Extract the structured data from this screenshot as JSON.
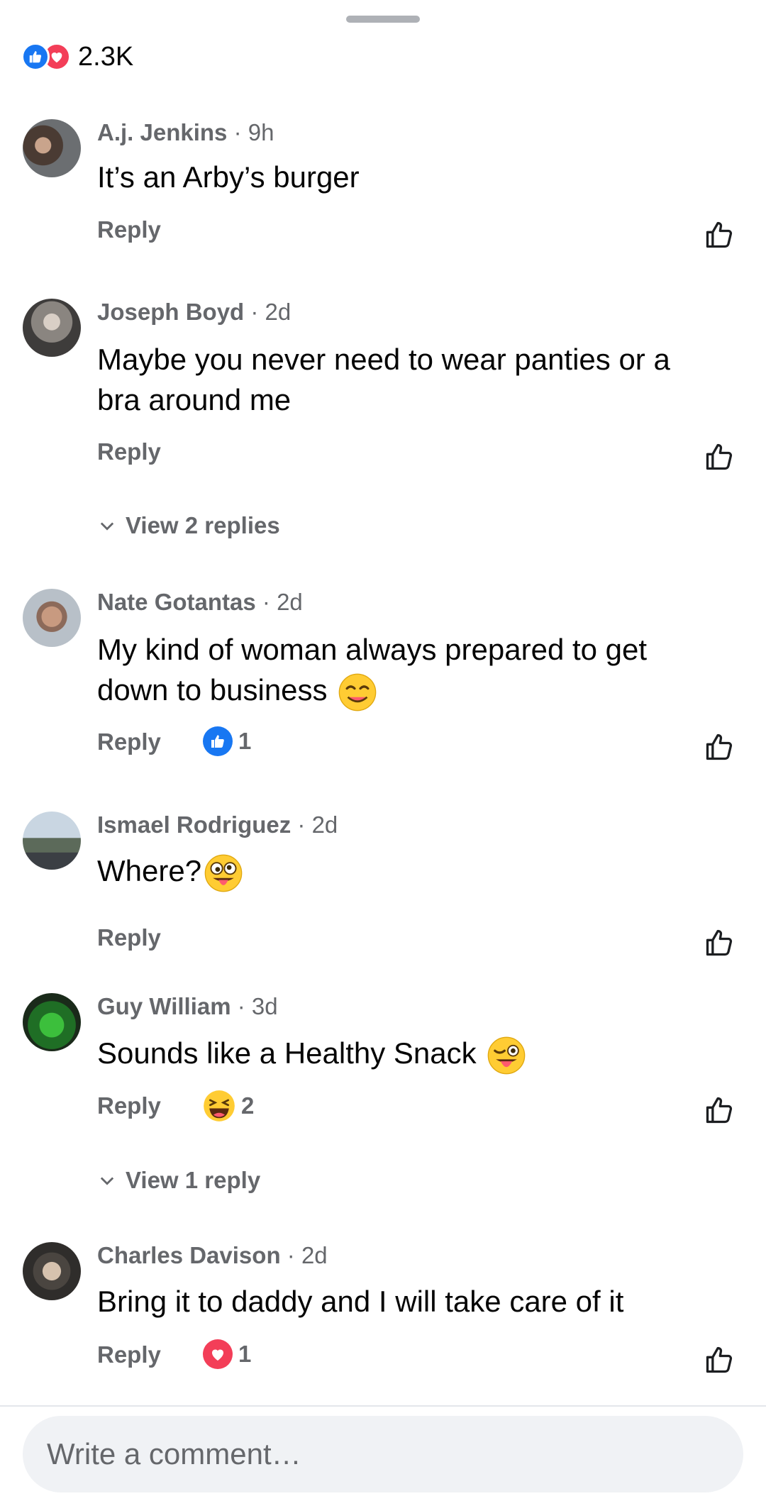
{
  "reactions_summary": {
    "count": "2.3K",
    "types": [
      "like-icon",
      "love-icon"
    ],
    "colors": {
      "like": "#1877f2",
      "love": "#f33e58"
    }
  },
  "comments": [
    {
      "author": "A.j. Jenkins",
      "separator": "·",
      "time": "9h",
      "text": "It’s an Arby’s burger",
      "reply_label": "Reply"
    },
    {
      "author": "Joseph Boyd",
      "separator": "·",
      "time": "2d",
      "text": "Maybe you never need to wear panties or a bra around me",
      "reply_label": "Reply",
      "view_replies": "View 2 replies"
    },
    {
      "author": "Nate Gotantas",
      "separator": "·",
      "time": "2d",
      "text": "My kind of woman always prepared to get down to business",
      "emoji": "smirk-face",
      "reply_label": "Reply",
      "reaction": {
        "type": "like",
        "count": "1"
      }
    },
    {
      "author": "Ismael Rodriguez",
      "separator": "·",
      "time": "2d",
      "text": "Where?",
      "emoji": "goofy-tongue-face",
      "reply_label": "Reply"
    },
    {
      "author": "Guy William",
      "separator": "·",
      "time": "3d",
      "text": "Sounds like a Healthy Snack",
      "emoji": "winking-tongue-face",
      "reply_label": "Reply",
      "reaction": {
        "type": "haha",
        "count": "2"
      },
      "view_replies": "View 1 reply"
    },
    {
      "author": "Charles Davison",
      "separator": "·",
      "time": "2d",
      "text": "Bring it to daddy and I will take care of it",
      "reply_label": "Reply",
      "reaction": {
        "type": "love",
        "count": "1"
      }
    }
  ],
  "composer": {
    "placeholder": "Write a comment…"
  }
}
